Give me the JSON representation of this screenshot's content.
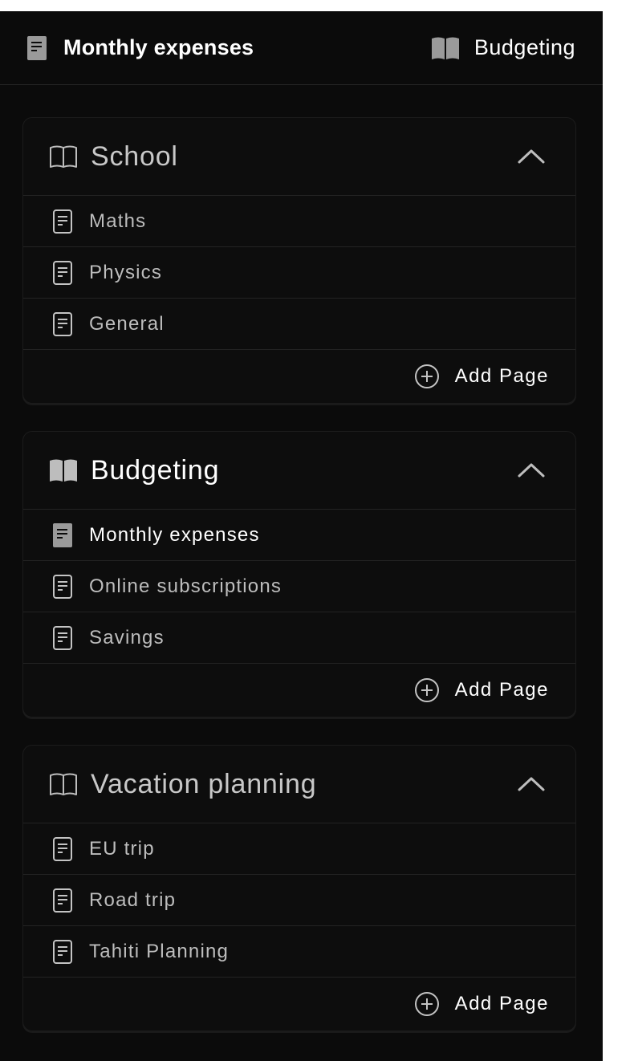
{
  "topbar": {
    "page_title": "Monthly expenses",
    "page_icon": "document-filled-icon",
    "notebook_title": "Budgeting",
    "notebook_icon": "book-open-filled-icon"
  },
  "notebooks": [
    {
      "name": "School",
      "icon": "book-open-outline-icon",
      "expanded": true,
      "pages": [
        {
          "label": "Maths",
          "active": false
        },
        {
          "label": "Physics",
          "active": false
        },
        {
          "label": "General",
          "active": false
        }
      ],
      "add_label": "Add Page"
    },
    {
      "name": "Budgeting",
      "icon": "book-open-filled-icon",
      "expanded": true,
      "active": true,
      "pages": [
        {
          "label": "Monthly expenses",
          "active": true
        },
        {
          "label": "Online subscriptions",
          "active": false
        },
        {
          "label": "Savings",
          "active": false
        }
      ],
      "add_label": "Add Page"
    },
    {
      "name": "Vacation planning",
      "icon": "book-open-outline-icon",
      "expanded": true,
      "pages": [
        {
          "label": "EU trip",
          "active": false
        },
        {
          "label": "Road trip",
          "active": false
        },
        {
          "label": "Tahiti Planning",
          "active": false
        }
      ],
      "add_label": "Add Page"
    }
  ],
  "colors": {
    "background": "#0b0b0b",
    "border": "#232323",
    "text_active": "#ffffff",
    "text_inactive": "#bdbdbd",
    "icon": "#c4c4c4"
  }
}
